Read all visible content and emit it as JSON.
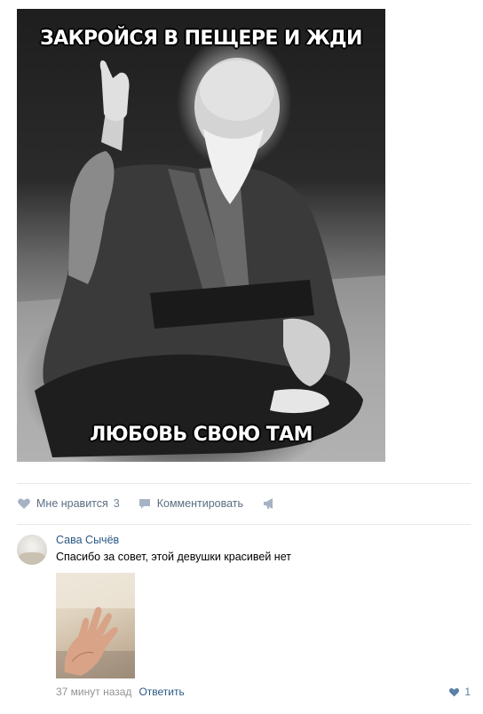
{
  "post": {
    "meme": {
      "top_caption": "ЗАКРОЙСЯ В ПЕЩЕРЕ И ЖДИ",
      "bottom_caption": "ЛЮБОВЬ СВОЮ ТАМ"
    },
    "actions": {
      "like_label": "Мне нравится",
      "like_count": "3",
      "comment_label": "Комментировать"
    }
  },
  "comment": {
    "author": "Сава Сычёв",
    "text": "Спасибо за совет, этой девушки красивей нет",
    "time": "37 минут назад",
    "reply_label": "Ответить",
    "like_count": "1"
  },
  "colors": {
    "link": "#2a5885",
    "action_text": "#5b6d83",
    "muted": "#939393",
    "divider": "#e7e8ec"
  },
  "icons": [
    "heart-icon",
    "comment-icon",
    "share-icon"
  ]
}
